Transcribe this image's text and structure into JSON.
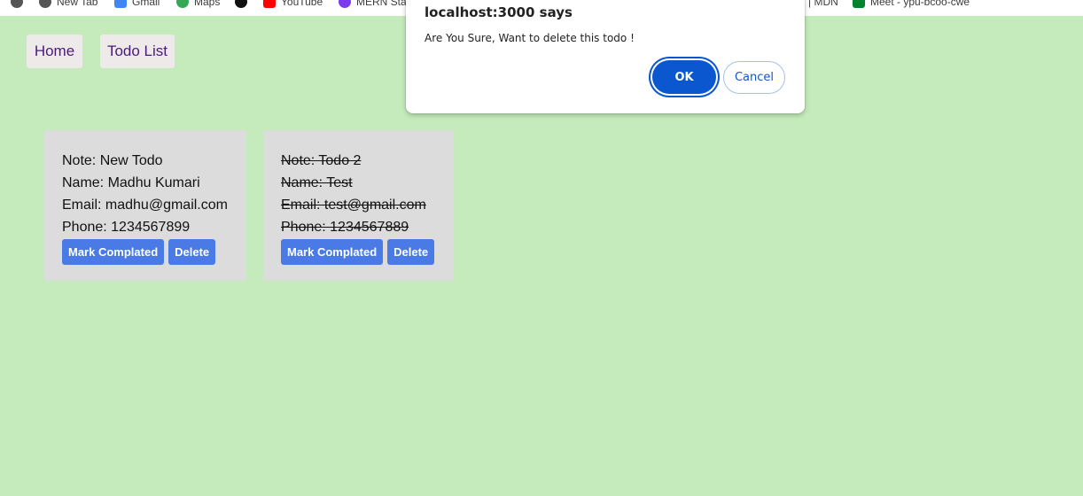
{
  "bookmarks": [
    {
      "label": "",
      "icon": "chrome-icon"
    },
    {
      "label": "New Tab",
      "icon": "chrome-icon"
    },
    {
      "label": "Gmail",
      "icon": "gmail-icon"
    },
    {
      "label": "Maps",
      "icon": "maps-pin-icon"
    },
    {
      "label": "",
      "icon": "github-icon"
    },
    {
      "label": "YouTube",
      "icon": "youtube-icon"
    },
    {
      "label": "MERN Sta",
      "icon": "mern-icon"
    },
    {
      "label": "| MDN",
      "icon": ""
    },
    {
      "label": "Meet - ypu-bcoo-cwe",
      "icon": "meet-icon"
    }
  ],
  "nav": {
    "home_label": "Home",
    "todo_list_label": "Todo List"
  },
  "todos": [
    {
      "note": "Note: New Todo",
      "name": "Name: Madhu Kumari",
      "email": "Email: madhu@gmail.com",
      "phone": "Phone: 1234567899",
      "completed": false
    },
    {
      "note": "Note: Todo 2",
      "name": "Name: Test",
      "email": "Email: test@gmail.com",
      "phone": "Phone: 1234567889",
      "completed": true
    }
  ],
  "buttons": {
    "mark_completed": "Mark Complated",
    "delete": "Delete"
  },
  "dialog": {
    "title": "localhost:3000 says",
    "message": "Are You Sure, Want to delete this todo !",
    "ok_label": "OK",
    "cancel_label": "Cancel"
  },
  "colors": {
    "background": "#c5ebbc",
    "card": "#dcdcdc",
    "action_button": "#4a7ae6",
    "nav_text": "#4b1a78",
    "dialog_accent": "#0b57d0"
  }
}
